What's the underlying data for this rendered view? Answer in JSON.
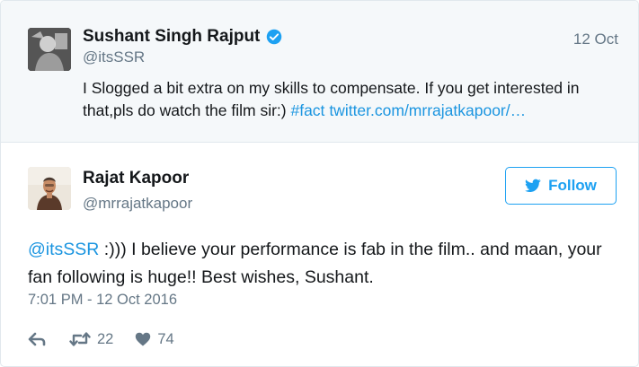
{
  "quoted_tweet": {
    "author_name": "Sushant Singh Rajput",
    "author_handle": "@itsSSR",
    "date": "12 Oct",
    "text_before": "I Slogged a bit extra on my skills to compensate. If you get interested in that,pls do watch the film sir:) ",
    "hashtag": "#fact",
    "link": "twitter.com/mrrajatkapoor/…"
  },
  "tweet": {
    "author_name": "Rajat Kapoor",
    "author_handle": "@mrrajatkapoor",
    "follow_label": "Follow",
    "mention": "@itsSSR",
    "text": " :))) I believe your performance is fab in the film.. and maan, your fan following is huge!! Best wishes, Sushant.",
    "timestamp": "7:01 PM - 12 Oct 2016",
    "retweet_count": "22",
    "like_count": "74"
  },
  "colors": {
    "accent": "#1da1f2",
    "link": "#1b95e0",
    "muted": "#657786",
    "quoted_background": "#f5f8fa",
    "like_heart": "#657786"
  },
  "icons": {
    "verified": "verified-badge-icon",
    "follow": "twitter-bird-icon",
    "reply": "reply-icon",
    "retweet": "retweet-icon",
    "like": "heart-icon"
  }
}
